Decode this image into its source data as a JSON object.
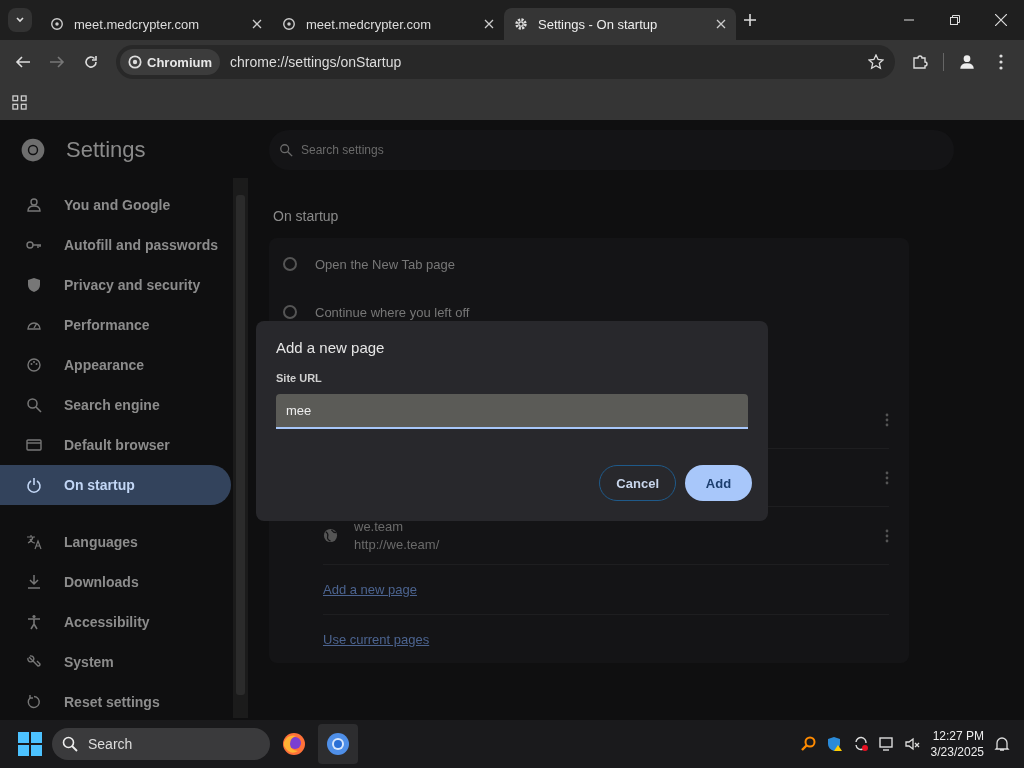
{
  "tabs": [
    {
      "title": "meet.medcrypter.com",
      "kind": "site",
      "selected": false
    },
    {
      "title": "meet.medcrypter.com",
      "kind": "site",
      "selected": false
    },
    {
      "title": "Settings - On startup",
      "kind": "settings",
      "selected": true
    }
  ],
  "omnibox": {
    "chip": "Chromium",
    "url": "chrome://settings/onStartup"
  },
  "settings": {
    "title": "Settings",
    "search_placeholder": "Search settings",
    "sidebar": [
      {
        "label": "You and Google",
        "selected": false
      },
      {
        "label": "Autofill and passwords",
        "selected": false
      },
      {
        "label": "Privacy and security",
        "selected": false
      },
      {
        "label": "Performance",
        "selected": false
      },
      {
        "label": "Appearance",
        "selected": false
      },
      {
        "label": "Search engine",
        "selected": false
      },
      {
        "label": "Default browser",
        "selected": false
      },
      {
        "label": "On startup",
        "selected": true
      },
      {
        "label": "Languages",
        "selected": false
      },
      {
        "label": "Downloads",
        "selected": false
      },
      {
        "label": "Accessibility",
        "selected": false
      },
      {
        "label": "System",
        "selected": false
      },
      {
        "label": "Reset settings",
        "selected": false
      }
    ],
    "section_title": "On startup",
    "options": [
      {
        "label": "Open the New Tab page",
        "selected": false
      },
      {
        "label": "Continue where you left off",
        "selected": false
      }
    ],
    "pages": [
      {
        "name": "we.team",
        "url": "http://we.team/"
      }
    ],
    "links": [
      "Add a new page",
      "Use current pages"
    ]
  },
  "dialog": {
    "title": "Add a new page",
    "field_label": "Site URL",
    "value": "mee",
    "buttons": [
      {
        "label": "Cancel",
        "kind": "secondary"
      },
      {
        "label": "Add",
        "kind": "primary"
      }
    ]
  },
  "taskbar": {
    "search_placeholder": "Search",
    "time": "12:27 PM",
    "date": "3/23/2025"
  }
}
